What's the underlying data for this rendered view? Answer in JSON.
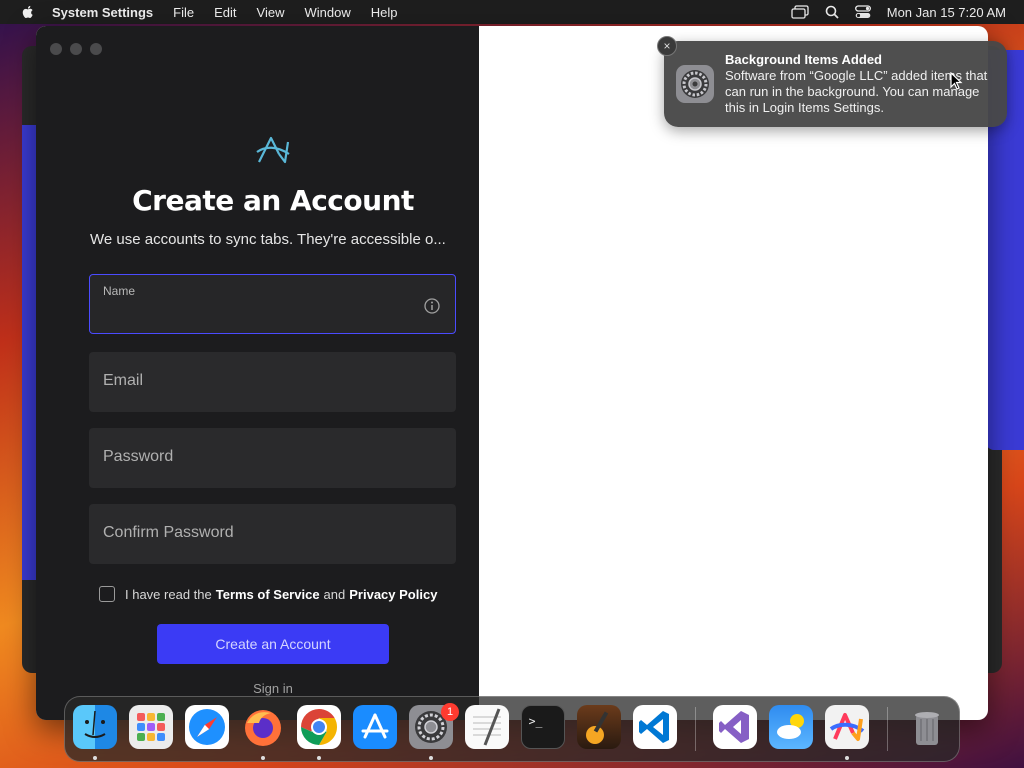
{
  "menubar": {
    "app_name": "System Settings",
    "menus": [
      "File",
      "Edit",
      "View",
      "Window",
      "Help"
    ],
    "datetime": "Mon Jan 15  7:20 AM"
  },
  "form": {
    "title": "Create an Account",
    "subtitle": "We use accounts to sync tabs. They're accessible o...",
    "name_label": "Name",
    "name_value": "",
    "email_placeholder": "Email",
    "password_placeholder": "Password",
    "confirm_placeholder": "Confirm Password",
    "terms_prefix": "I have read the",
    "terms_link": "Terms of Service",
    "terms_and": "and",
    "privacy_link": "Privacy Policy",
    "terms_checked": false,
    "create_button": "Create an Account",
    "signin_link": "Sign in"
  },
  "notification": {
    "title": "Background Items Added",
    "body": "Software from “Google LLC” added items that can run in the background. You can manage this in Login Items Settings.",
    "close_label": "×",
    "icon": "system-settings-gear-icon"
  },
  "dock": {
    "apps": [
      "Finder",
      "Launchpad",
      "Safari",
      "Firefox",
      "Chrome",
      "App Store",
      "System Settings",
      "TextEdit",
      "Terminal",
      "GarageBand",
      "Visual Studio Code",
      "Visual Studio",
      "Weather",
      "Arc",
      "Trash"
    ],
    "settings_badge": "1"
  },
  "colors": {
    "accent": "#3b3bf5",
    "panel_bg": "#1c1c1e",
    "field_bg": "#2a2a2c",
    "focus_border": "#4b4bff"
  }
}
